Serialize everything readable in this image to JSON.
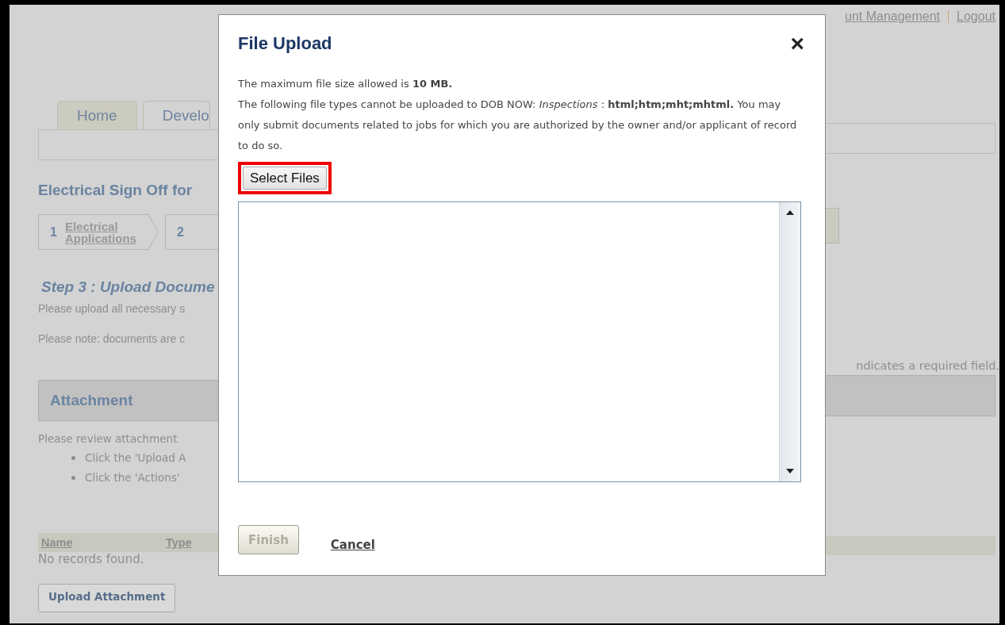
{
  "background": {
    "top_links": [
      "unt Management",
      "Logout"
    ],
    "tabs": [
      {
        "label": "Home",
        "selected": false
      },
      {
        "label": "Develo",
        "selected": true
      }
    ],
    "heading": "Electrical Sign Off for",
    "steps": [
      {
        "number": "1",
        "label": "Electrical Applications"
      },
      {
        "number": "2"
      }
    ],
    "step_title": "Step 3 : Upload Docume",
    "notes": [
      "Please upload all necessary s",
      "Please note: documents are c"
    ],
    "required_note": "ndicates a required field.",
    "section_title": "Attachment",
    "review_text": "Please review attachment",
    "bullets": [
      "Click the 'Upload A",
      "Click the 'Actions'"
    ],
    "columns": [
      "Name",
      "Type"
    ],
    "empty_text": "No records found.",
    "upload_button": "Upload Attachment"
  },
  "dialog": {
    "title": "File Upload",
    "close": "×",
    "paragraphs": [
      "The maximum file size allowed is **10 MB.**",
      "The following file types cannot be uploaded to DOB NOW: *Inspections* : **html;htm;mht;mhtml.** You may only submit documents related to jobs for which you are authorized by the owner and/or applicant of record to do so."
    ],
    "select_button": {
      "label": "Select Files",
      "highlighted": true
    },
    "finish_button": {
      "label": "Finish",
      "disabled": true
    },
    "cancel_link": "Cancel"
  }
}
